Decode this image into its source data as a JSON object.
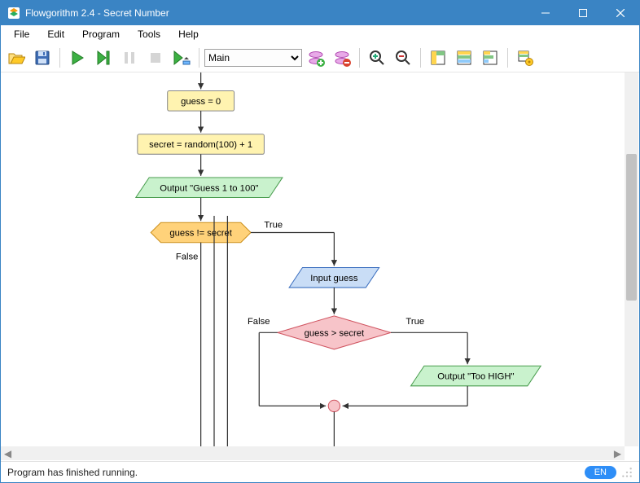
{
  "window": {
    "title": "Flowgorithm 2.4 - Secret Number"
  },
  "menu": {
    "file": "File",
    "edit": "Edit",
    "program": "Program",
    "tools": "Tools",
    "help": "Help"
  },
  "toolbar": {
    "function_selected": "Main"
  },
  "flowchart": {
    "assign1": "guess = 0",
    "assign2": "secret = random(100) + 1",
    "output1": "Output \"Guess 1 to 100\"",
    "while_cond": "guess != secret",
    "while_true": "True",
    "while_false": "False",
    "input1": "Input guess",
    "if_cond": "guess > secret",
    "if_true": "True",
    "if_false": "False",
    "output2": "Output \"Too HIGH\""
  },
  "status": {
    "message": "Program has finished running.",
    "lang": "EN"
  }
}
